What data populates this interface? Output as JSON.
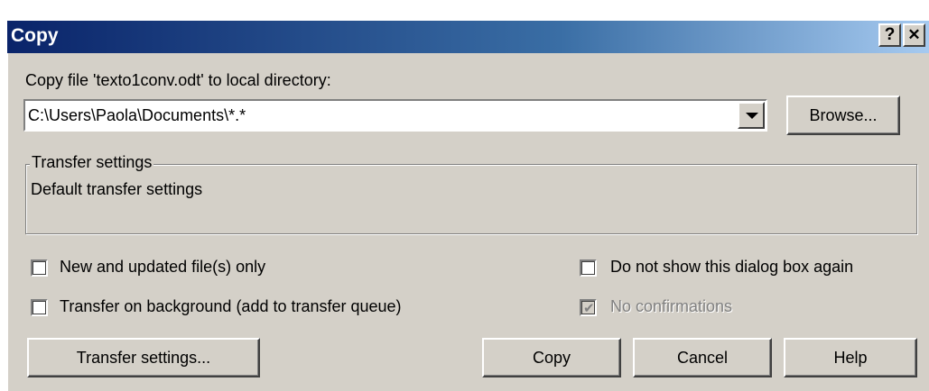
{
  "window": {
    "title": "Copy",
    "help_label": "?",
    "close_label": "✕"
  },
  "copy_prompt": "Copy file 'texto1conv.odt' to local directory:",
  "destination": {
    "value": "C:\\Users\\Paola\\Documents\\*.*"
  },
  "browse_label": "Browse...",
  "transfer_group": {
    "legend": "Transfer settings",
    "text": "Default transfer settings"
  },
  "options": {
    "new_updated": {
      "label": "New and updated file(s) only",
      "checked": false
    },
    "background": {
      "label": "Transfer on background (add to transfer queue)",
      "checked": false
    },
    "do_not_show": {
      "label": "Do not show this dialog box again",
      "checked": false
    },
    "no_confirmations": {
      "label": "No confirmations",
      "checked": true,
      "disabled": true
    }
  },
  "buttons": {
    "transfer_settings": "Transfer settings...",
    "copy": "Copy",
    "cancel": "Cancel",
    "help": "Help"
  },
  "colors": {
    "title_start": "#0a246a",
    "title_end": "#a6caf0",
    "face": "#d4d0c8"
  }
}
